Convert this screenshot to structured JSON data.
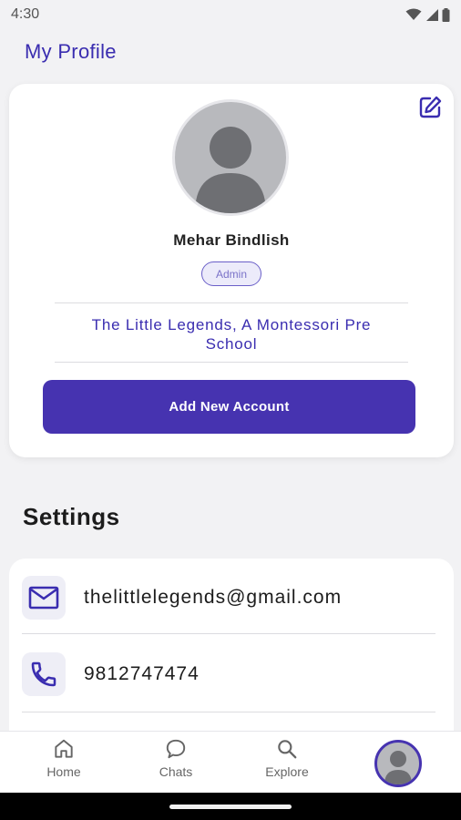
{
  "status_bar": {
    "time": "4:30"
  },
  "header": {
    "title": "My Profile"
  },
  "profile": {
    "name": "Mehar Bindlish",
    "role": "Admin",
    "school": "The Little Legends, A Montessori Pre School",
    "add_account_label": "Add New Account"
  },
  "settings": {
    "title": "Settings",
    "items": [
      {
        "icon": "mail-icon",
        "value": "thelittlelegends@gmail.com"
      },
      {
        "icon": "phone-icon",
        "value": "9812747474"
      }
    ]
  },
  "bottom_nav": {
    "items": [
      {
        "icon": "home-icon",
        "label": "Home"
      },
      {
        "icon": "chat-icon",
        "label": "Chats"
      },
      {
        "icon": "search-icon",
        "label": "Explore"
      },
      {
        "icon": "avatar-icon",
        "label": ""
      }
    ]
  },
  "colors": {
    "accent": "#4633b0",
    "title": "#3a2db0",
    "background": "#f2f2f4"
  }
}
